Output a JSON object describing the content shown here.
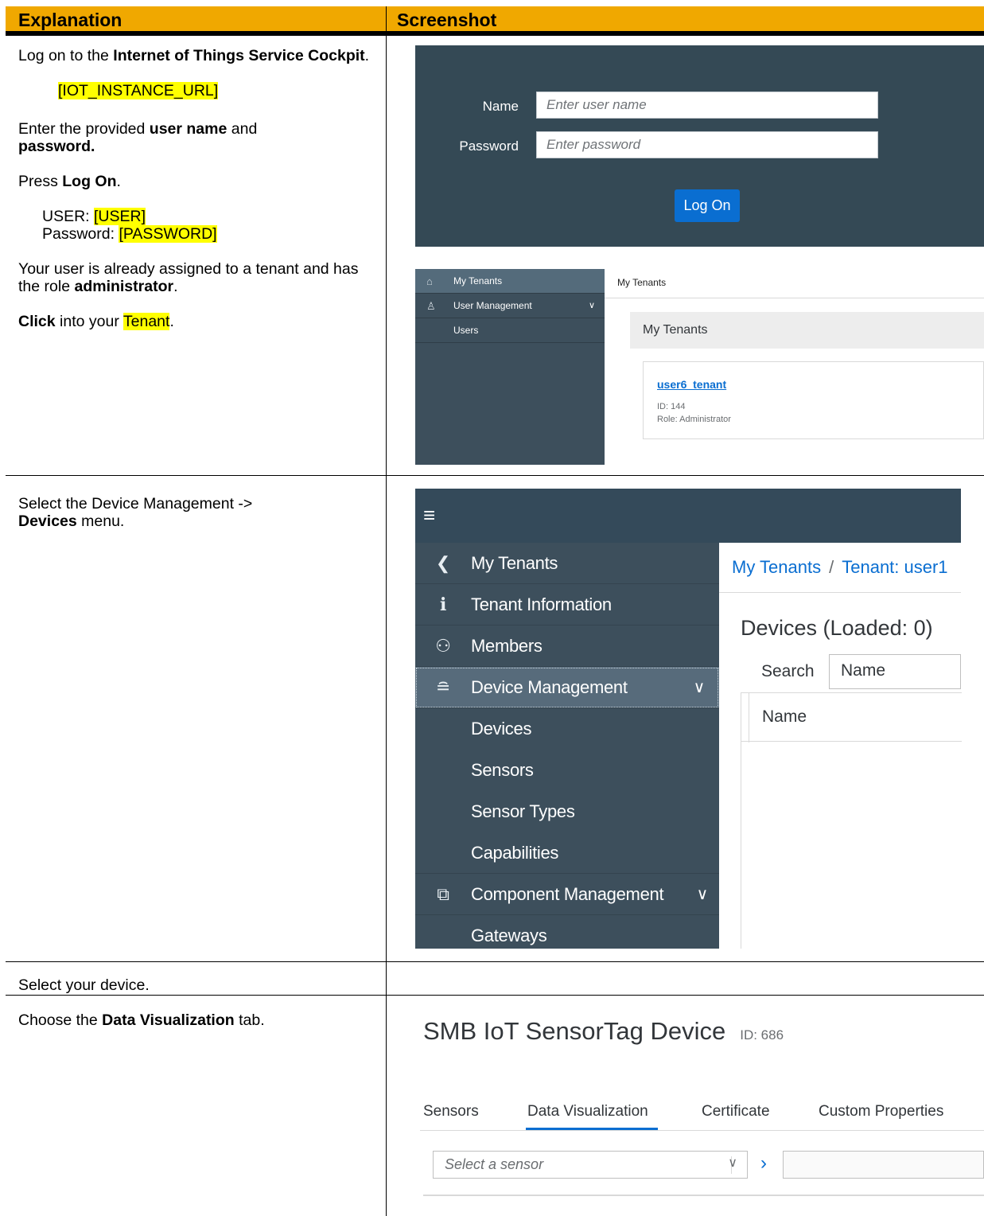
{
  "table": {
    "col_explanation": "Explanation",
    "col_screenshot": "Screenshot"
  },
  "rows": [
    {
      "explanation": {
        "p1_pre": "Log on to the ",
        "p1_bold": "Internet of Things Service Cockpit",
        "p1_post": ".",
        "url_placeholder": "[IOT_INSTANCE_URL]",
        "p2_pre": "Enter the provided ",
        "p2_bold1": "user name",
        "p2_mid": " and ",
        "p2_bold2": "password.",
        "p3_pre": "Press ",
        "p3_bold": "Log On",
        "p3_post": ".",
        "user_label": "USER: ",
        "user_value": "[USER]",
        "password_label": "Password: ",
        "password_value": "[PASSWORD]",
        "p4_pre": "Your user is already assigned to a tenant and has the role ",
        "p4_bold": "administrator",
        "p4_post": ".",
        "p5_bold": "Click",
        "p5_mid": " into your ",
        "p5_hl": "Tenant",
        "p5_post": "."
      },
      "login": {
        "name_label": "Name",
        "name_placeholder": "Enter user name",
        "password_label": "Password",
        "password_placeholder": "Enter password",
        "logon_button": "Log On"
      },
      "tenants": {
        "sidebar": [
          "My Tenants",
          "User Management",
          "Users"
        ],
        "breadcrumb": "My Tenants",
        "section_title": "My Tenants",
        "tenant_name": "user6_tenant",
        "tenant_id": "ID: 144",
        "tenant_role": "Role: Administrator"
      }
    },
    {
      "explanation": {
        "pre": "Select the Device Management -> ",
        "bold": "Devices",
        "post": " menu."
      },
      "nav": {
        "items": [
          "My Tenants",
          "Tenant Information",
          "Members",
          "Device Management",
          "Devices",
          "Sensors",
          "Sensor Types",
          "Capabilities",
          "Component Management",
          "Gateways"
        ]
      },
      "main": {
        "breadcrumb_1": "My Tenants",
        "breadcrumb_sep": "/",
        "breadcrumb_2": "Tenant: user1",
        "page_title": "Devices (Loaded: 0)",
        "search_label": "Search",
        "search_value": "Name",
        "column_name": "Name"
      }
    },
    {
      "explanation": "Select your device."
    },
    {
      "explanation": {
        "pre": "Choose the ",
        "bold": "Data Visualization",
        "post": " tab."
      },
      "device": {
        "title": "SMB IoT SensorTag Device",
        "id": "ID: 686",
        "tabs": [
          "Sensors",
          "Data Visualization",
          "Certificate",
          "Custom Properties"
        ],
        "sensor_placeholder": "Select a sensor"
      }
    }
  ]
}
